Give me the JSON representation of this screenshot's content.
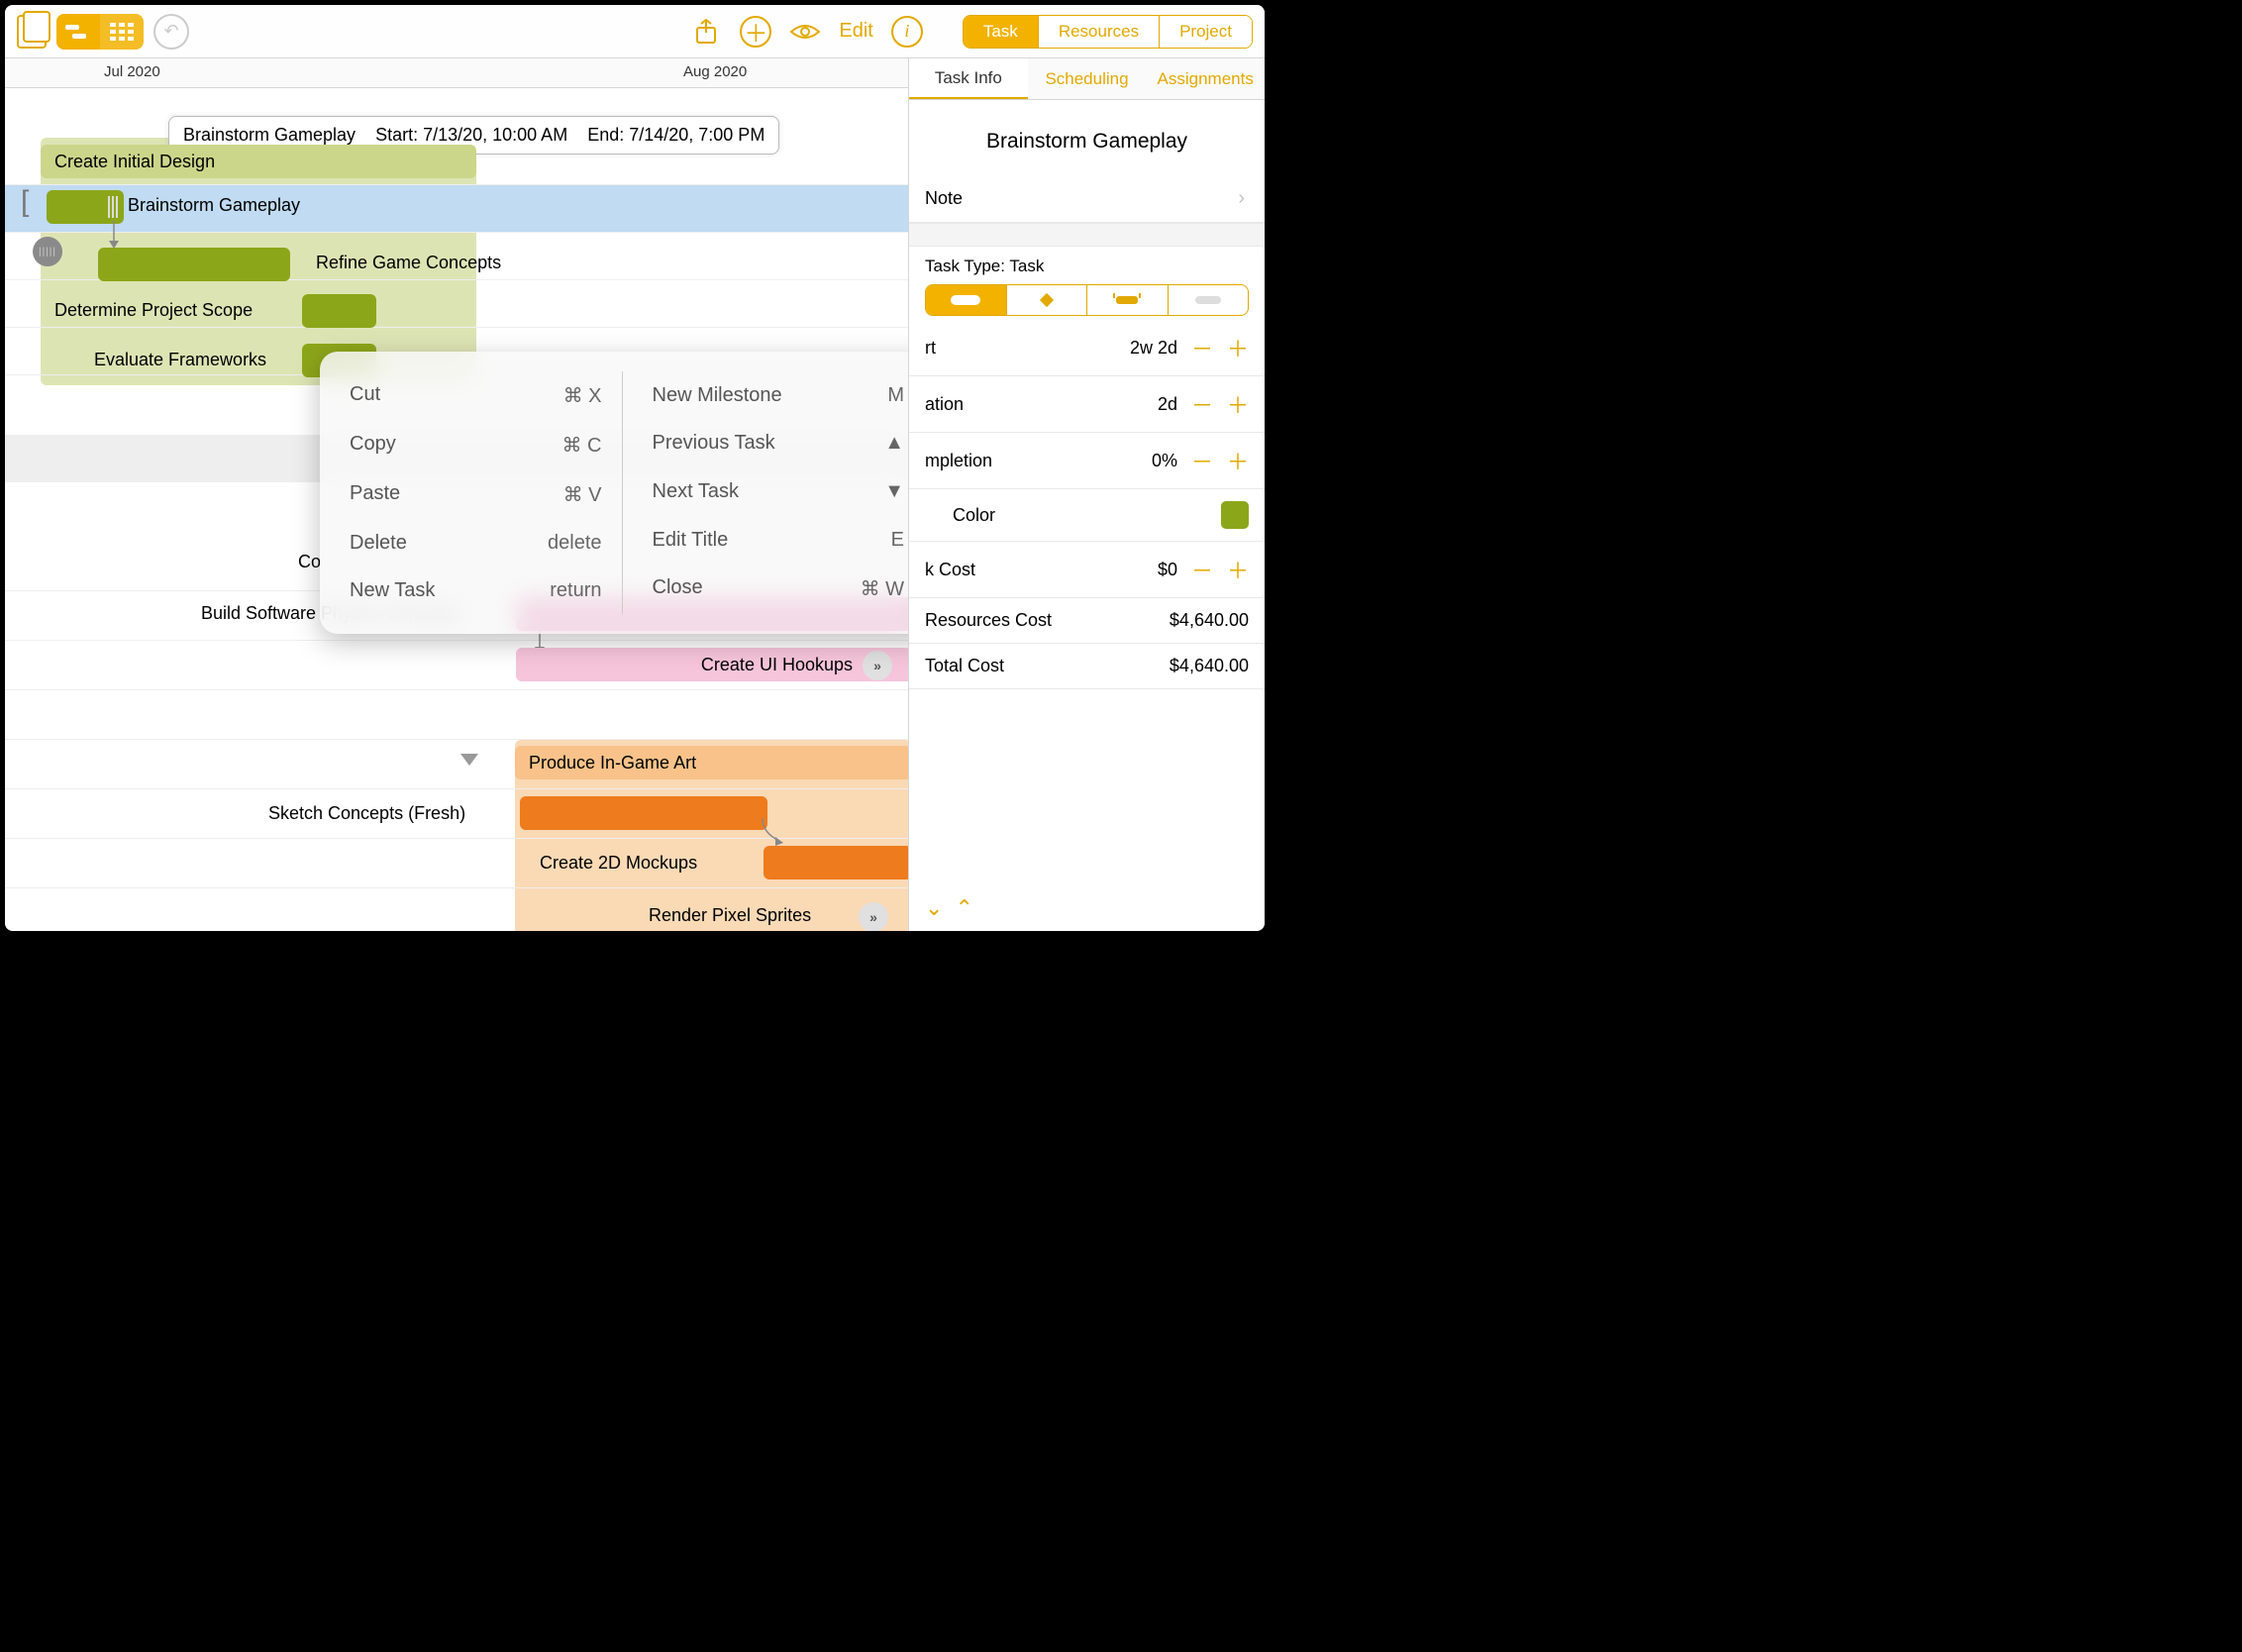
{
  "scope_seg": {
    "task": "Task",
    "resources": "Resources",
    "project": "Project"
  },
  "edit_label": "Edit",
  "timeline": {
    "jul": "Jul 2020",
    "aug": "Aug 2020"
  },
  "tooltip": {
    "name": "Brainstorm Gameplay",
    "start": "Start: 7/13/20, 10:00 AM",
    "end": "End: 7/14/20, 7:00 PM"
  },
  "tasks": {
    "create_initial_design": "Create Initial Design",
    "brainstorm_gameplay": "Brainstorm Gameplay",
    "refine_concepts": "Refine Game Concepts",
    "determine_scope": "Determine Project Scope",
    "evaluate_frameworks": "Evaluate Frameworks",
    "co_prefix": "Co",
    "build_physics": "Build Software Physics Simulator",
    "create_ui_hookups": "Create UI Hookups",
    "produce_art": "Produce In-Game Art",
    "sketch_concepts": "Sketch Concepts (Fresh)",
    "create_2d": "Create 2D Mockups",
    "render_sprites": "Render Pixel Sprites"
  },
  "menu": {
    "cut": "Cut",
    "cut_k": "⌘ X",
    "copy": "Copy",
    "copy_k": "⌘ C",
    "paste": "Paste",
    "paste_k": "⌘ V",
    "delete": "Delete",
    "delete_k": "delete",
    "new_task": "New Task",
    "new_task_k": "return",
    "new_milestone": "New Milestone",
    "new_milestone_k": "M",
    "prev_task": "Previous Task",
    "prev_task_k": "▲",
    "next_task": "Next Task",
    "next_task_k": "▼",
    "edit_title": "Edit Title",
    "edit_title_k": "E",
    "close": "Close",
    "close_k": "⌘ W"
  },
  "inspector": {
    "tabs": {
      "info": "Task Info",
      "scheduling": "Scheduling",
      "assignments": "Assignments"
    },
    "title": "Brainstorm Gameplay",
    "note": "Note",
    "task_type_label": "Task Type: Task",
    "effort_label": "rt",
    "effort_value": "2w 2d",
    "duration_label": "ation",
    "duration_value": "2d",
    "completion_label": "mpletion",
    "completion_value": "0%",
    "color_label": "Color",
    "task_cost_label": "k Cost",
    "task_cost_value": "$0",
    "resources_cost_label": "Resources Cost",
    "resources_cost_value": "$4,640.00",
    "total_cost_label": "Total Cost",
    "total_cost_value": "$4,640.00"
  }
}
